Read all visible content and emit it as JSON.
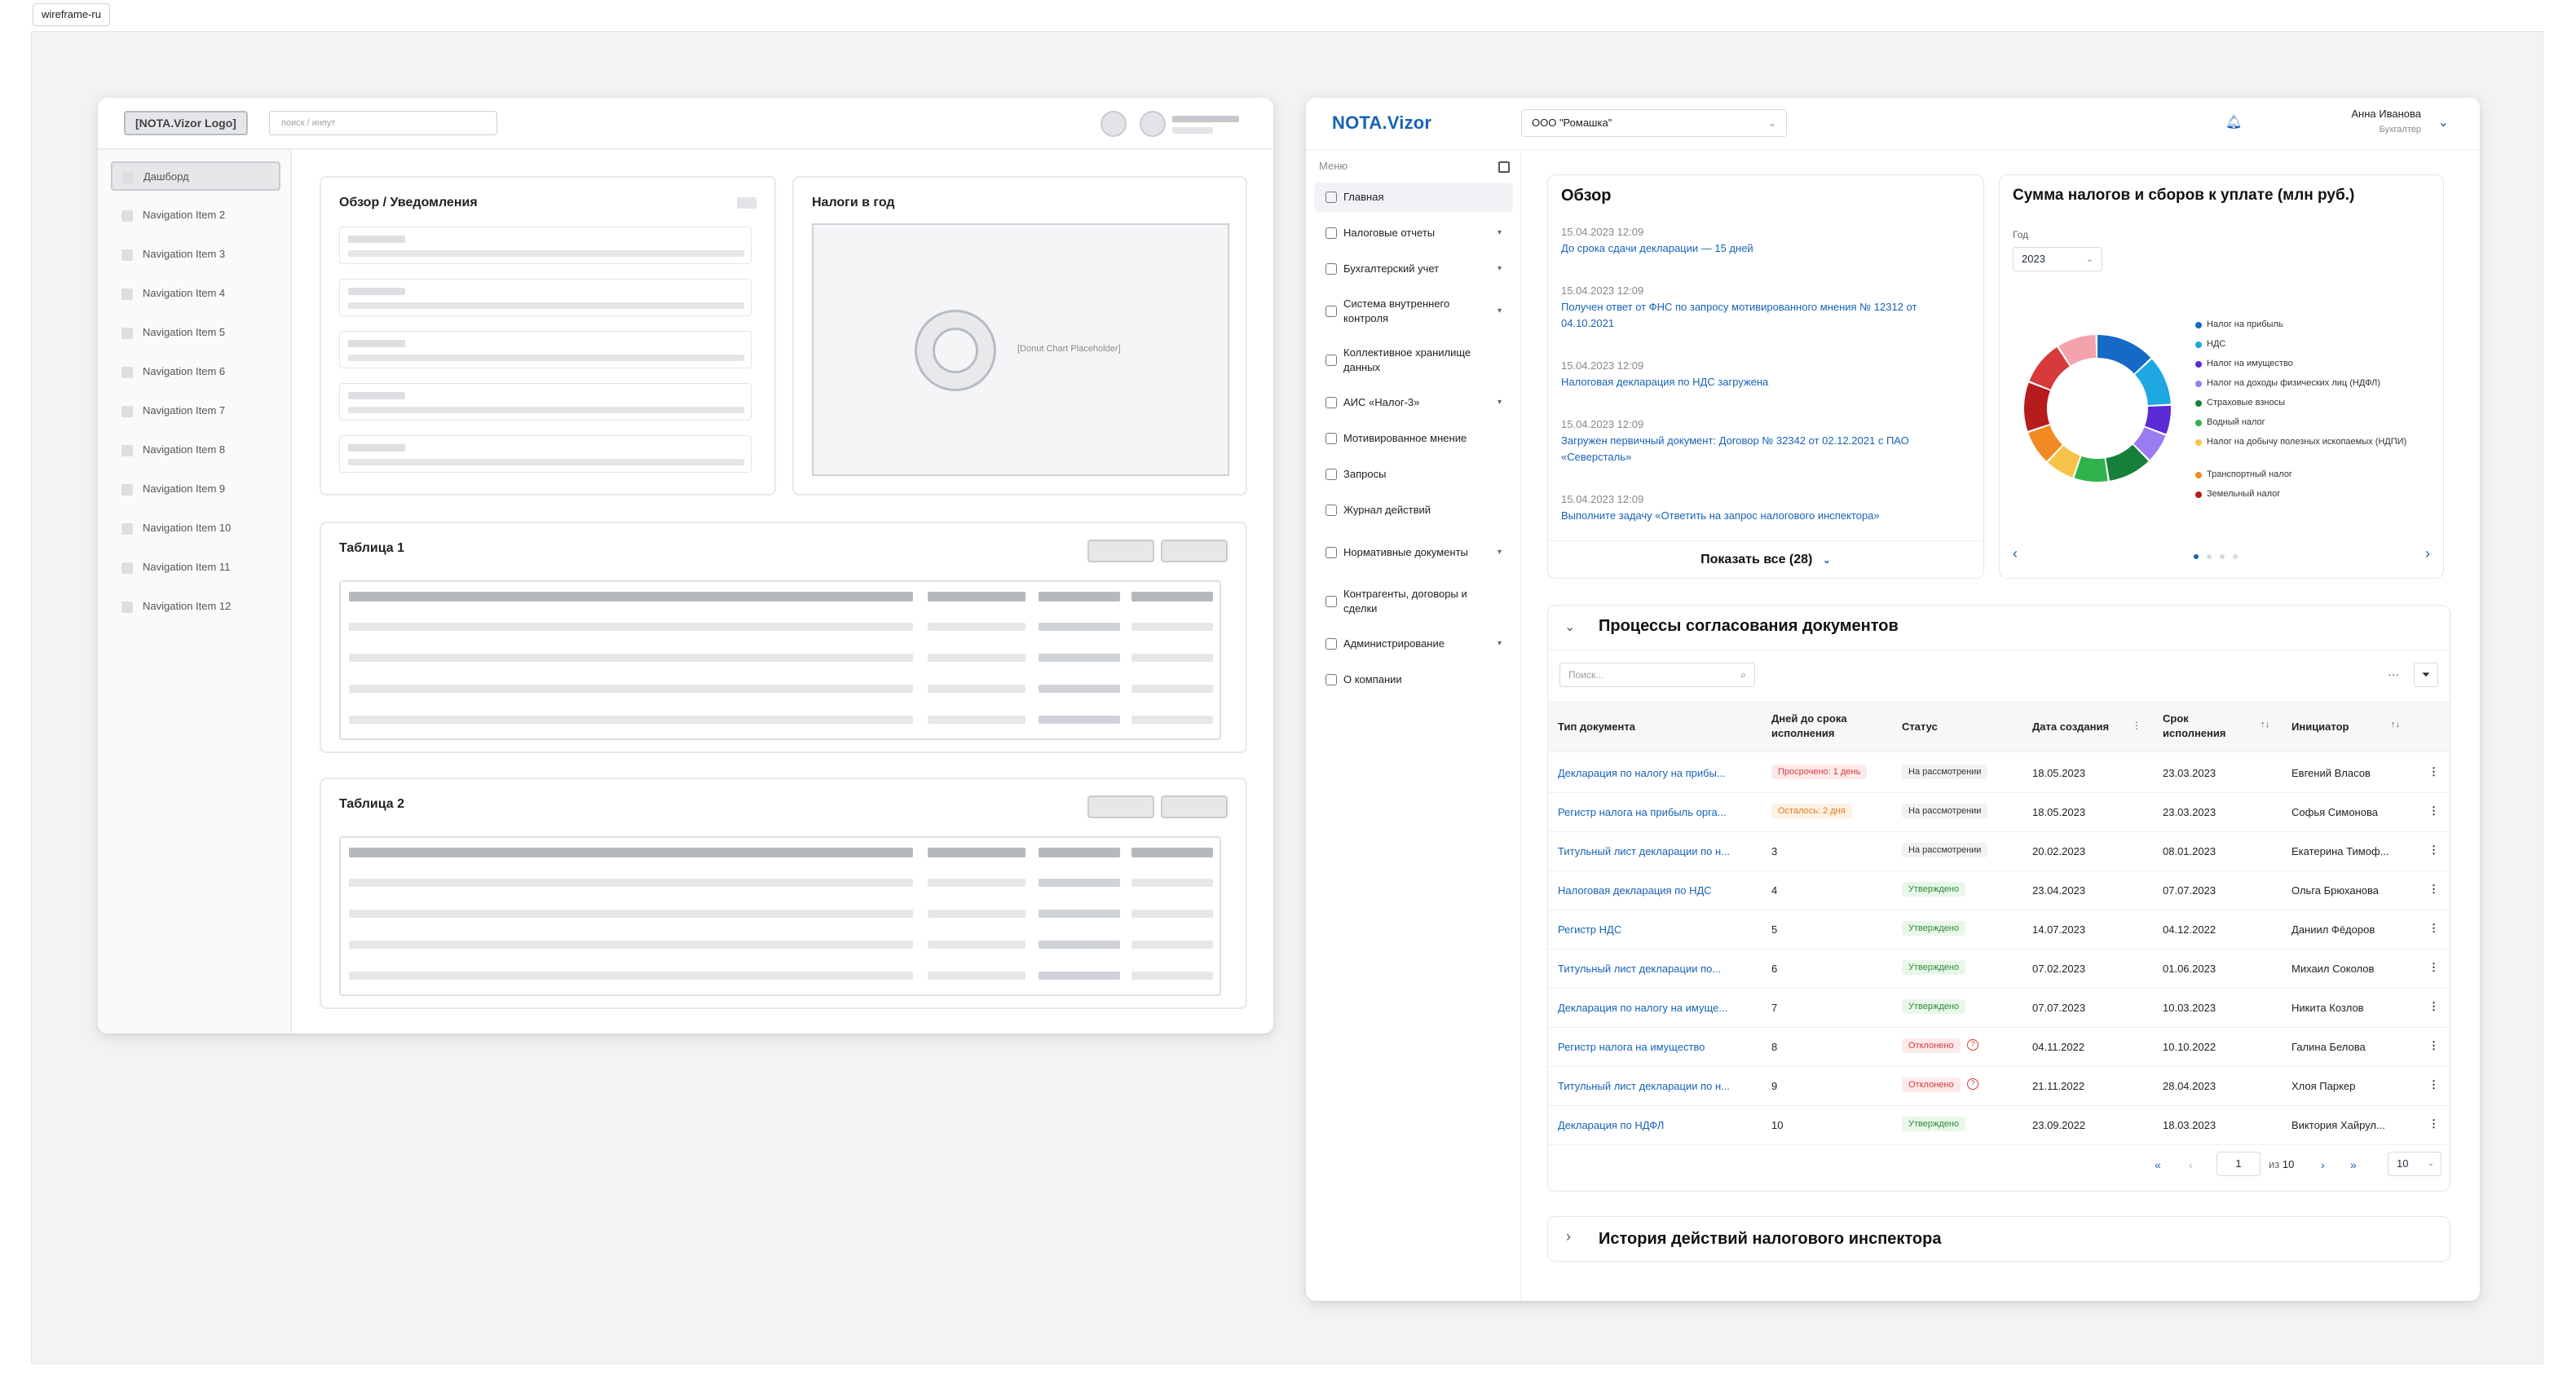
{
  "tag": "wireframe-ru",
  "wireframe": {
    "logo": "[NOTA.Vizor Logo]",
    "search_placeholder": "поиск / инпут",
    "nav": [
      "Дашборд",
      "Navigation Item 2",
      "Navigation Item 3",
      "Navigation Item 4",
      "Navigation Item 5",
      "Navigation Item 6",
      "Navigation Item 7",
      "Navigation Item 8",
      "Navigation Item 9",
      "Navigation Item 10",
      "Navigation Item 11",
      "Navigation Item 12"
    ],
    "overview_title": "Обзор / Уведомления",
    "taxes_title": "Налоги в год",
    "donut_placeholder": "[Donut Chart Placeholder]",
    "table1_title": "Таблица 1",
    "table2_title": "Таблица 2"
  },
  "app": {
    "logo": "NOTA.Vizor",
    "company": "ООО \"Ромашка\"",
    "user_name": "Анна Иванова",
    "user_role": "Бухгалтер",
    "menu_header": "Меню",
    "menu": [
      {
        "label": "Главная",
        "dd": false
      },
      {
        "label": "Налоговые отчеты",
        "dd": true
      },
      {
        "label": "Бухгалтерский учет",
        "dd": true
      },
      {
        "label": "Система внутреннего контроля",
        "dd": true
      },
      {
        "label": "Коллективное хранилище данных",
        "dd": false
      },
      {
        "label": "АИС «Налог-3»",
        "dd": true
      },
      {
        "label": "Мотивированное мнение",
        "dd": false
      },
      {
        "label": "Запросы",
        "dd": false
      },
      {
        "label": "Журнал действий",
        "dd": false
      },
      {
        "label": "Нормативные документы",
        "dd": true
      },
      {
        "label": "Контрагенты, договоры и сделки",
        "dd": false
      },
      {
        "label": "Администрирование",
        "dd": true
      },
      {
        "label": "О компании",
        "dd": false
      }
    ],
    "overview": {
      "title": "Обзор",
      "items": [
        {
          "date": "15.04.2023  12:09",
          "text": "До срока сдачи декларации — 15 дней"
        },
        {
          "date": "15.04.2023  12:09",
          "text": "Получен ответ от ФНС по запросу мотивированного мнения № 12312 от 04.10.2021"
        },
        {
          "date": "15.04.2023  12:09",
          "text": "Налоговая декларация по НДС загружена"
        },
        {
          "date": "15.04.2023  12:09",
          "text": "Загружен первичный документ: Договор № 32342 от 02.12.2021 с ПАО «Северсталь»"
        },
        {
          "date": "15.04.2023  12:09",
          "text": "Выполните задачу «Ответить на запрос налогового инспектора»"
        }
      ],
      "show_all": "Показать все (28)"
    },
    "taxes": {
      "title": "Сумма налогов и сборов к уплате (млн руб.)",
      "year_label": "Год",
      "year": "2023"
    },
    "processes": {
      "title": "Процессы согласования документов",
      "search_placeholder": "Поиск...",
      "headers": [
        "Тип документа",
        "Дней до срока исполнения",
        "Статус",
        "Дата создания",
        "Срок исполнения",
        "Инициатор"
      ],
      "rows": [
        {
          "type": "Декларация по налогу на прибы...",
          "days": "",
          "badge": "Просрочено: 1 день",
          "bclass": "b-late",
          "status": "На рассмотрении",
          "sclass": "b-review",
          "created": "18.05.2023",
          "due": "23.03.2023",
          "who": "Евгений Власов"
        },
        {
          "type": "Регистр налога на прибыль орга...",
          "days": "",
          "badge": "Осталось: 2 дня",
          "bclass": "b-left",
          "status": "На рассмотрении",
          "sclass": "b-review",
          "created": "18.05.2023",
          "due": "23.03.2023",
          "who": "Софья Симонова"
        },
        {
          "type": "Титульный лист декларации по н...",
          "days": "3",
          "badge": "",
          "bclass": "",
          "status": "На рассмотрении",
          "sclass": "b-review",
          "created": "20.02.2023",
          "due": "08.01.2023",
          "who": "Екатерина Тимоф..."
        },
        {
          "type": "Налоговая декларация по НДС",
          "days": "4",
          "badge": "",
          "bclass": "",
          "status": "Утверждено",
          "sclass": "b-ok",
          "created": "23.04.2023",
          "due": "07.07.2023",
          "who": "Ольга Брюханова"
        },
        {
          "type": "Регистр НДС",
          "days": "5",
          "badge": "",
          "bclass": "",
          "status": "Утверждено",
          "sclass": "b-ok",
          "created": "14.07.2023",
          "due": "04.12.2022",
          "who": "Даниил Фёдоров"
        },
        {
          "type": "Титульный лист декларации по...",
          "days": "6",
          "badge": "",
          "bclass": "",
          "status": "Утверждено",
          "sclass": "b-ok",
          "created": "07.02.2023",
          "due": "01.06.2023",
          "who": "Михаил Соколов"
        },
        {
          "type": "Декларация по налогу на имуще...",
          "days": "7",
          "badge": "",
          "bclass": "",
          "status": "Утверждено",
          "sclass": "b-ok",
          "created": "07.07.2023",
          "due": "10.03.2023",
          "who": "Никита Козлов"
        },
        {
          "type": "Регистр налога на имущество",
          "days": "8",
          "badge": "",
          "bclass": "",
          "status": "Отклонено",
          "sclass": "b-rej",
          "created": "04.11.2022",
          "due": "10.10.2022",
          "who": "Галина Белова"
        },
        {
          "type": "Титульный лист декларации по н...",
          "days": "9",
          "badge": "",
          "bclass": "",
          "status": "Отклонено",
          "sclass": "b-rej",
          "created": "21.11.2022",
          "due": "28.04.2023",
          "who": "Хлоя Паркер"
        },
        {
          "type": "Декларация по НДФЛ",
          "days": "10",
          "badge": "",
          "bclass": "",
          "status": "Утверждено",
          "sclass": "b-ok",
          "created": "23.09.2022",
          "due": "18.03.2023",
          "who": "Виктория Хайрул..."
        }
      ],
      "page": "1",
      "of": "из",
      "total_pages": "10",
      "page_size": "10"
    },
    "history_title": "История действий налогового инспектора"
  },
  "chart_data": {
    "type": "pie",
    "title": "Сумма налогов и сборов к уплате (млн руб.)",
    "categories": [
      "Налог на прибыль",
      "НДС",
      "Налог на имущество",
      "Налог на доходы физических лиц (НДФЛ)",
      "Страховые взносы",
      "Водный налог",
      "Налог на добычу полезных ископаемых (НДПИ)",
      "Транспортный налог",
      "Земельный налог"
    ],
    "colors": [
      "#1769c7",
      "#1ea7e1",
      "#5b2bd6",
      "#9b7cf0",
      "#16803a",
      "#2fb14b",
      "#f6c24a",
      "#f18a22",
      "#b71c1c"
    ],
    "segment_colors": [
      "#1769c7",
      "#1ea7e1",
      "#5b2bd6",
      "#9b7cf0",
      "#16803a",
      "#2fb14b",
      "#f6c24a",
      "#f18a22",
      "#b71c1c",
      "#d63a3a",
      "#f4a3ad"
    ],
    "values": [
      12,
      10,
      6,
      6,
      9,
      7,
      6,
      7,
      10,
      9,
      8
    ]
  }
}
